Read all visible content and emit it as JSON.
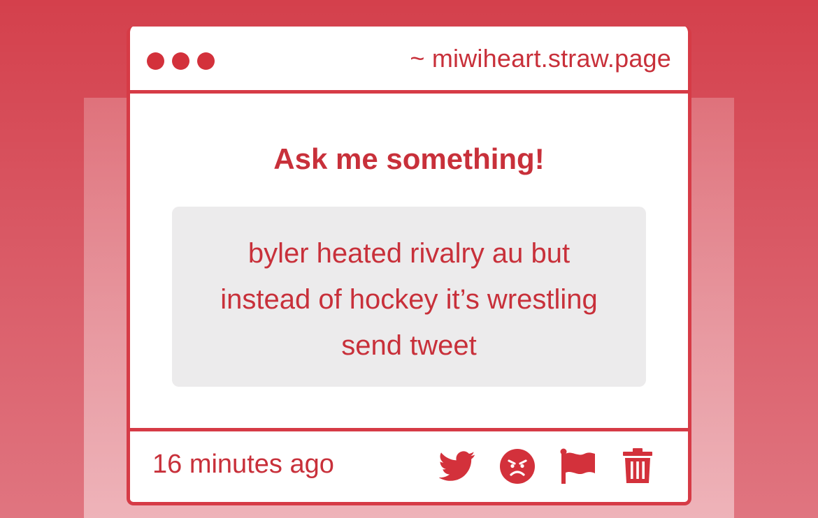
{
  "window": {
    "url": "~ miwiheart.straw.page"
  },
  "main": {
    "title": "Ask me something!",
    "message_lines": [
      "byler heated rivalry au but",
      "instead of hockey it’s wrestling",
      "send tweet"
    ]
  },
  "footer": {
    "timestamp": "16 minutes ago",
    "actions": [
      {
        "icon": "twitter-icon"
      },
      {
        "icon": "angry-face-icon"
      },
      {
        "icon": "flag-icon"
      },
      {
        "icon": "trash-icon"
      }
    ]
  },
  "colors": {
    "accent": "#d3313b",
    "text": "#c8303a",
    "message_bg": "#ecebec",
    "page_bg": "#d4404c"
  }
}
